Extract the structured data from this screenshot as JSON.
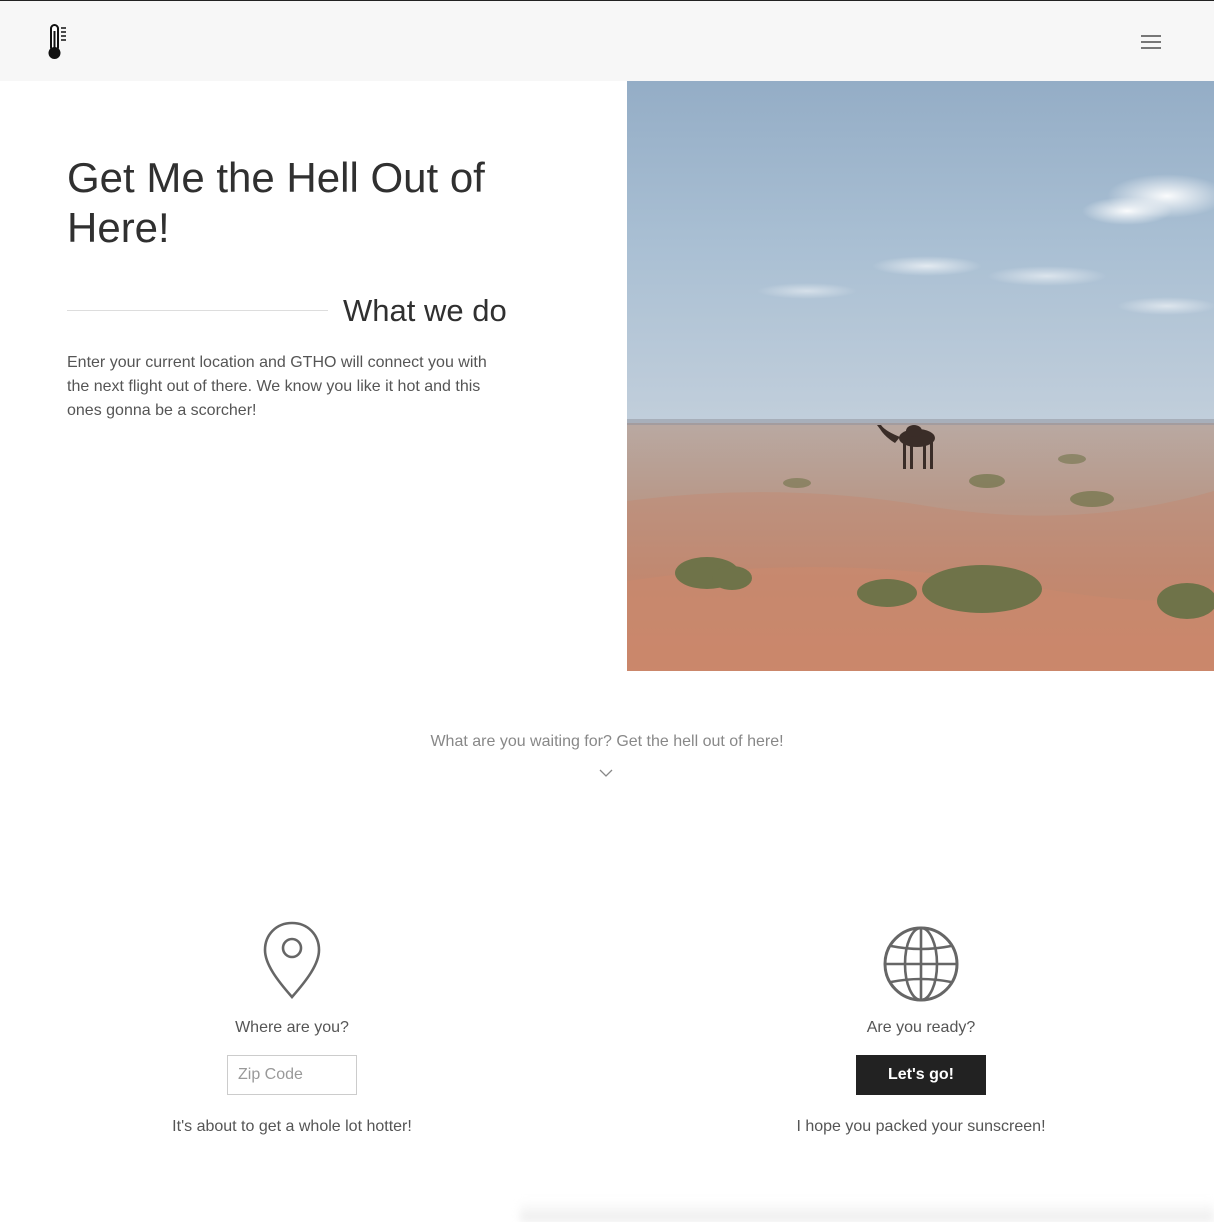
{
  "header": {
    "logo_icon": "thermometer-icon",
    "menu_icon": "hamburger-menu-icon"
  },
  "hero": {
    "title": "Get Me the Hell Out of Here!",
    "section_heading": "What we do",
    "description": "Enter your current location and GTHO will connect you with the next flight out of there. We know you like it hot and this ones gonna be a scorcher!",
    "image_subject": "desert-camel-photo"
  },
  "cta": {
    "text": "What are you waiting for? Get the hell out of here!",
    "icon": "chevron-down-icon"
  },
  "features": {
    "location": {
      "icon": "map-pin-icon",
      "heading": "Where are you?",
      "zip_placeholder": "Zip Code",
      "zip_value": "",
      "footer": "It's about to get a whole lot hotter!"
    },
    "ready": {
      "icon": "globe-icon",
      "heading": "Are you ready?",
      "button_label": "Let's go!",
      "footer": "I hope you packed your sunscreen!"
    }
  },
  "colors": {
    "navbar_bg": "#f7f7f7",
    "button_bg": "#222222",
    "text_dark": "#303030",
    "text_muted": "#888888"
  }
}
